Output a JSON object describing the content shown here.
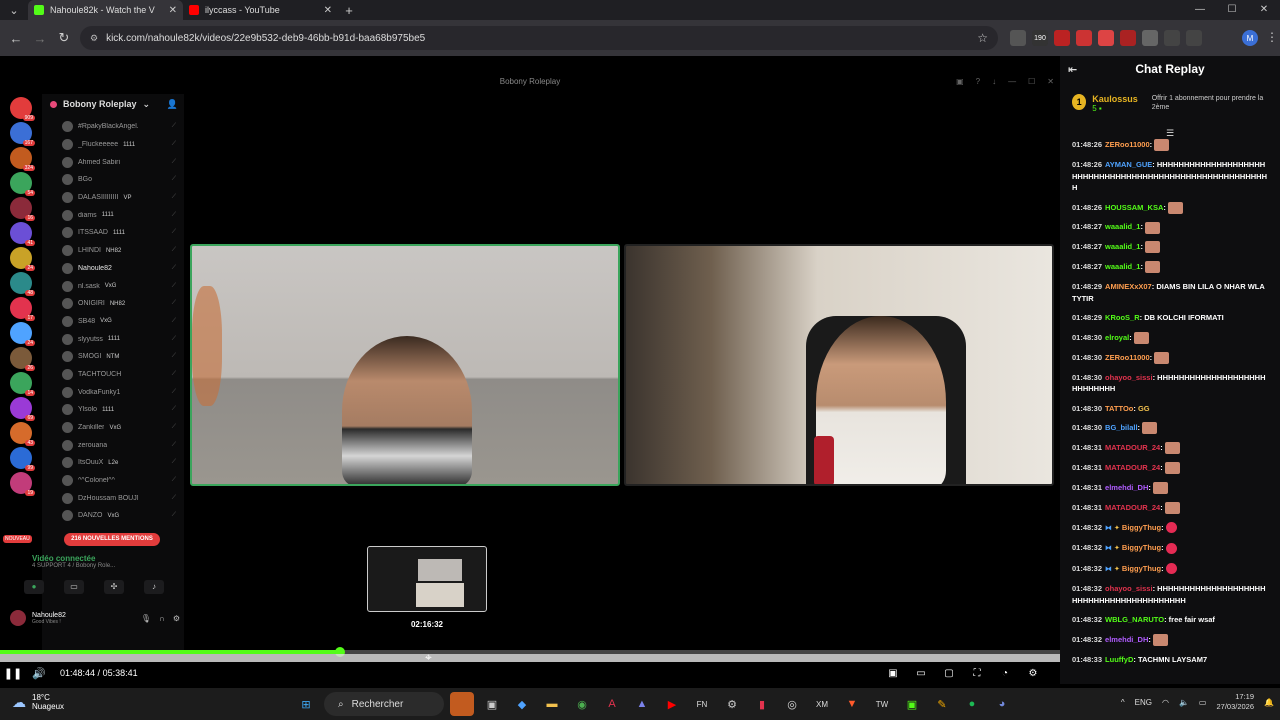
{
  "browser": {
    "tabs": [
      {
        "title": "Nahoule82k - Watch the V",
        "active": true,
        "color": "#53fc18"
      },
      {
        "title": "ilyccass - YouTube",
        "active": false,
        "color": "#ff0000"
      }
    ],
    "url": "kick.com/nahoule82k/videos/22e9b532-deb9-46bb-b91d-baa68b975be5",
    "extension_badges": [
      "190"
    ],
    "profile_initial": "M"
  },
  "video": {
    "window_title": "Bobony Roleplay",
    "thumbnail_time": "02:16:32",
    "current_time": "01:48:44",
    "duration": "05:38:41",
    "progress_fraction": 0.321
  },
  "discord": {
    "server_name": "Bobony Roleplay",
    "server_badges": [
      "909",
      "167",
      "324",
      "54",
      "16",
      "41",
      "24",
      "48",
      "17",
      "24",
      "26",
      "14",
      "69",
      "43",
      "99",
      "19"
    ],
    "members": [
      {
        "name": "#RpakyBlackAngel...",
        "tag": "",
        "dim": true
      },
      {
        "name": "_Fluckeeeee",
        "tag": "1111",
        "dim": true
      },
      {
        "name": "Ahmed Sabiri",
        "tag": "",
        "dim": true
      },
      {
        "name": "BGo",
        "tag": "",
        "dim": true
      },
      {
        "name": "DALASIIIIIIIII",
        "tag": "VP",
        "dim": true
      },
      {
        "name": "diams",
        "tag": "1111",
        "dim": true
      },
      {
        "name": "ITSSAAD",
        "tag": "1111",
        "dim": true
      },
      {
        "name": "LHINDI",
        "tag": "NH82",
        "dim": true
      },
      {
        "name": "Nahoule82",
        "tag": "",
        "dim": false
      },
      {
        "name": "nl.sask",
        "tag": "VxG",
        "dim": true
      },
      {
        "name": "ONIGIRI",
        "tag": "NH82",
        "dim": true
      },
      {
        "name": "SB48",
        "tag": "VxG",
        "dim": true
      },
      {
        "name": "slyyutss",
        "tag": "1111",
        "dim": true
      },
      {
        "name": "SMOGI",
        "tag": "NTM",
        "dim": true
      },
      {
        "name": "TACHTOUCH",
        "tag": "",
        "dim": true
      },
      {
        "name": "VodkaFunky1",
        "tag": "",
        "dim": true
      },
      {
        "name": "Ylsolo",
        "tag": "1111",
        "dim": true
      },
      {
        "name": "Zankiller",
        "tag": "VxG",
        "dim": true
      },
      {
        "name": "zerouana",
        "tag": "",
        "dim": true
      },
      {
        "name": "ItsOuuX",
        "tag": "L2e",
        "dim": true
      },
      {
        "name": "^^Colonel^^",
        "tag": "",
        "dim": true
      },
      {
        "name": "DzHoussam BOUJM3A",
        "tag": "",
        "dim": true
      },
      {
        "name": "DANZO",
        "tag": "VxG",
        "dim": true
      }
    ],
    "mentions_label": "216 NOUVELLES MENTIONS",
    "new_label": "NOUVEAU",
    "voice_status": "Vidéo connectée",
    "voice_channel": "4 SUPPORT 4 / Bobony Role...",
    "me_name": "Nahoule82",
    "me_status": "Good Vibes !"
  },
  "chat": {
    "title": "Chat Replay",
    "pinned": {
      "rank": "1",
      "user": "Kaulossus",
      "count": "5",
      "gift_text": "Offrir 1 abonnement pour prendre la 2ème"
    },
    "messages": [
      {
        "ts": "01:48:26",
        "user": "ZERoo11000",
        "color": "#ff9e4f",
        "text": "",
        "emote": true
      },
      {
        "ts": "01:48:26",
        "user": "AYMAN_GUE",
        "color": "#4fa3ff",
        "text": "HHHHHHHHHHHHHHHHHHHHHHHHHHHHHHHHHHHHHHHHHHHHHHHHHHHHHHHHH",
        "emote": false
      },
      {
        "ts": "01:48:26",
        "user": "HOUSSAM_KSA",
        "color": "#53fc18",
        "text": "",
        "emote": true
      },
      {
        "ts": "01:48:27",
        "user": "waaalid_1",
        "color": "#53fc18",
        "text": "",
        "emote": true
      },
      {
        "ts": "01:48:27",
        "user": "waaalid_1",
        "color": "#53fc18",
        "text": "",
        "emote": true
      },
      {
        "ts": "01:48:27",
        "user": "waaalid_1",
        "color": "#53fc18",
        "text": "",
        "emote": true
      },
      {
        "ts": "01:48:29",
        "user": "AMINEXxX07",
        "color": "#ff9e4f",
        "text": "DIAMS BIN LILA O NHAR WLA TYTIR",
        "emote": false
      },
      {
        "ts": "01:48:29",
        "user": "KRooS_R",
        "color": "#53fc18",
        "text": "DB KOLCHI IFORMATI",
        "emote": false
      },
      {
        "ts": "01:48:30",
        "user": "elroyal",
        "color": "#53fc18",
        "text": "",
        "emote": true
      },
      {
        "ts": "01:48:30",
        "user": "ZERoo11000",
        "color": "#ff9e4f",
        "text": "",
        "emote": true
      },
      {
        "ts": "01:48:30",
        "user": "ohayoo_sissi",
        "color": "#e2334e",
        "text": "HHHHHHHHHHHHHHHHHHHHHHHHHHHH",
        "emote": false
      },
      {
        "ts": "01:48:30",
        "user": "TATTOo",
        "color": "#ff9e4f",
        "text": "GG",
        "emote": false
      },
      {
        "ts": "01:48:30",
        "user": "BG_bilall",
        "color": "#4fa3ff",
        "text": "",
        "emote": true
      },
      {
        "ts": "01:48:31",
        "user": "MATADOUR_24",
        "color": "#e2334e",
        "text": "",
        "emote": true
      },
      {
        "ts": "01:48:31",
        "user": "MATADOUR_24",
        "color": "#e2334e",
        "text": "",
        "emote": true
      },
      {
        "ts": "01:48:31",
        "user": "elmehdi_DH",
        "color": "#b05cff",
        "text": "",
        "emote": true
      },
      {
        "ts": "01:48:31",
        "user": "MATADOUR_24",
        "color": "#e2334e",
        "text": "",
        "emote": true
      },
      {
        "ts": "01:48:32",
        "user": "BiggyThug",
        "color": "#ff9e4f",
        "text": "",
        "emote": false,
        "heart": true
      },
      {
        "ts": "01:48:32",
        "user": "BiggyThug",
        "color": "#ff9e4f",
        "text": "",
        "emote": false,
        "heart": true
      },
      {
        "ts": "01:48:32",
        "user": "BiggyThug",
        "color": "#ff9e4f",
        "text": "",
        "emote": false,
        "heart": true
      },
      {
        "ts": "01:48:32",
        "user": "ohayoo_sissi",
        "color": "#e2334e",
        "text": "HHHHHHHHHHHHHHHHHHHHHHHHHHHHHHHHHHHHHHHHH",
        "emote": false
      },
      {
        "ts": "01:48:32",
        "user": "WBLG_NARUTO",
        "color": "#53fc18",
        "text": "free fair wsaf",
        "emote": false
      },
      {
        "ts": "01:48:32",
        "user": "elmehdi_DH",
        "color": "#b05cff",
        "text": "",
        "emote": true
      },
      {
        "ts": "01:48:33",
        "user": "LuuffyD",
        "color": "#53fc18",
        "text": "TACHMN LAYSAM7",
        "emote": false
      }
    ]
  },
  "taskbar": {
    "weather_temp": "18°C",
    "weather_desc": "Nuageux",
    "search_label": "Rechercher",
    "lang": "ENG",
    "time": "17:19",
    "date": "27/03/2026"
  }
}
